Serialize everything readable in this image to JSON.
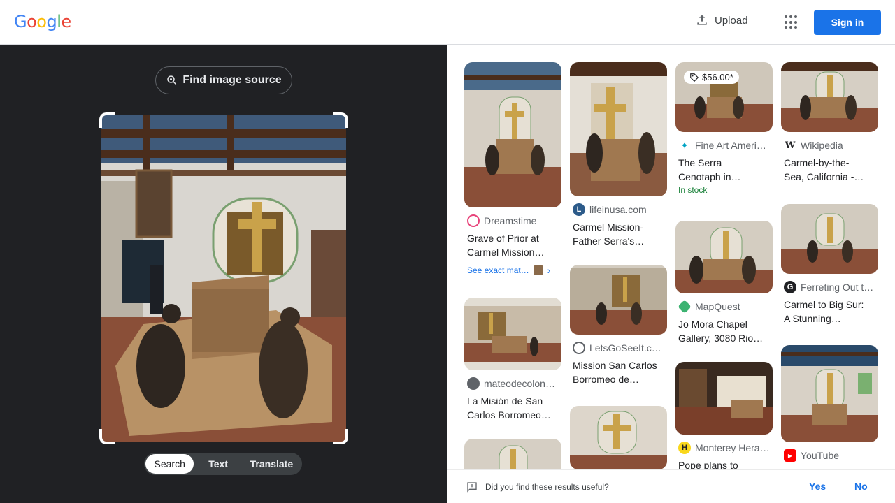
{
  "header": {
    "logo_letters": [
      "G",
      "o",
      "o",
      "g",
      "l",
      "e"
    ],
    "logo_colors": [
      "#4285F4",
      "#EA4335",
      "#FBBC05",
      "#4285F4",
      "#34A853",
      "#EA4335"
    ],
    "upload_label": "Upload",
    "signin_label": "Sign in"
  },
  "left": {
    "find_source_label": "Find image source",
    "modes": [
      "Search",
      "Text",
      "Translate"
    ],
    "active_mode": "Search"
  },
  "results": [
    {
      "source": "Dreamstime",
      "title_l1": "Grave of Prior at",
      "title_l2": "Carmel Mission…",
      "extra": "See exact mat…"
    },
    {
      "source": "mateodecolon…",
      "title_l1": "La Misión de San",
      "title_l2": "Carlos Borromeo…"
    },
    {
      "source": "lifeinusa.com",
      "title_l1": "Carmel Mission-",
      "title_l2": "Father Serra's…"
    },
    {
      "source": "LetsGoSeeIt.c…",
      "title_l1": "Mission San Carlos",
      "title_l2": "Borromeo de…"
    },
    {
      "source": "Fine Art Ameri…",
      "title_l1": "The Serra",
      "title_l2": "Cenotaph in…",
      "price": "$56.00*",
      "stock": "In stock"
    },
    {
      "source": "MapQuest",
      "title_l1": "Jo Mora Chapel",
      "title_l2": "Gallery, 3080 Rio…"
    },
    {
      "source": "Monterey Hera…",
      "title_l1": "Pope plans to",
      "title_l2": ""
    },
    {
      "source": "Wikipedia",
      "title_l1": "Carmel-by-the-",
      "title_l2": "Sea, California -…"
    },
    {
      "source": "Ferreting Out t…",
      "title_l1": "Carmel to Big Sur:",
      "title_l2": "A Stunning…"
    },
    {
      "source": "YouTube",
      "title_l1": "",
      "title_l2": ""
    }
  ],
  "feedback": {
    "question": "Did you find these results useful?",
    "yes": "Yes",
    "no": "No"
  }
}
